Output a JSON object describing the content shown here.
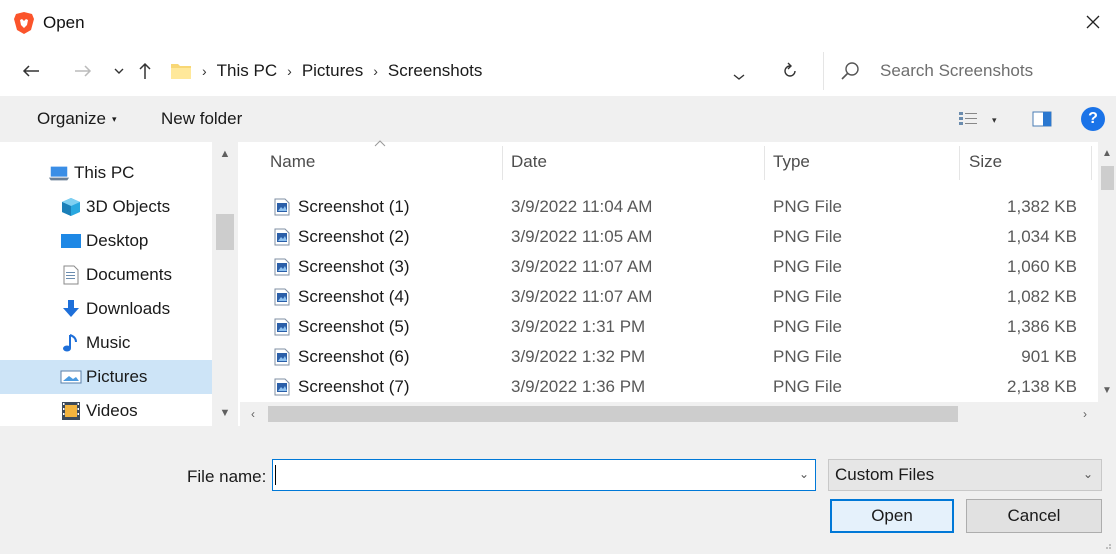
{
  "window": {
    "title": "Open",
    "close_glyph": "✕"
  },
  "nav": {
    "back": "←",
    "forward": "→",
    "recent": "⌄",
    "up": "↑"
  },
  "address": {
    "crumbs": [
      "This PC",
      "Pictures",
      "Screenshots"
    ],
    "separator": "›",
    "dropdown": "⌄",
    "refresh": "↻"
  },
  "search": {
    "placeholder": "Search Screenshots"
  },
  "toolbar": {
    "organize": "Organize",
    "organize_caret": "▾",
    "new_folder": "New folder",
    "help": "?",
    "view_caret": "▾"
  },
  "sidebar": {
    "items": [
      {
        "label": "This PC",
        "icon": "computer-icon"
      },
      {
        "label": "3D Objects",
        "icon": "cube-icon"
      },
      {
        "label": "Desktop",
        "icon": "desktop-icon"
      },
      {
        "label": "Documents",
        "icon": "document-icon"
      },
      {
        "label": "Downloads",
        "icon": "download-icon"
      },
      {
        "label": "Music",
        "icon": "music-icon"
      },
      {
        "label": "Pictures",
        "icon": "pictures-icon",
        "selected": true
      },
      {
        "label": "Videos",
        "icon": "video-icon"
      }
    ]
  },
  "columns": {
    "name": "Name",
    "date": "Date",
    "type": "Type",
    "size": "Size"
  },
  "files": [
    {
      "name": "Screenshot (1)",
      "date": "3/9/2022 11:04 AM",
      "type": "PNG File",
      "size": "1,382 KB"
    },
    {
      "name": "Screenshot (2)",
      "date": "3/9/2022 11:05 AM",
      "type": "PNG File",
      "size": "1,034 KB"
    },
    {
      "name": "Screenshot (3)",
      "date": "3/9/2022 11:07 AM",
      "type": "PNG File",
      "size": "1,060 KB"
    },
    {
      "name": "Screenshot (4)",
      "date": "3/9/2022 11:07 AM",
      "type": "PNG File",
      "size": "1,082 KB"
    },
    {
      "name": "Screenshot (5)",
      "date": "3/9/2022 1:31 PM",
      "type": "PNG File",
      "size": "1,386 KB"
    },
    {
      "name": "Screenshot (6)",
      "date": "3/9/2022 1:32 PM",
      "type": "PNG File",
      "size": "901 KB"
    },
    {
      "name": "Screenshot (7)",
      "date": "3/9/2022 1:36 PM",
      "type": "PNG File",
      "size": "2,138 KB"
    }
  ],
  "bottom": {
    "file_name_label": "File name:",
    "file_name_value": "",
    "filter": "Custom Files",
    "open_label": "Open",
    "cancel_label": "Cancel"
  },
  "colors": {
    "accent": "#0078d7",
    "selected_bg": "#cde4f7",
    "toolbar_bg": "#f0f0f0",
    "help": "#1a73e8"
  }
}
